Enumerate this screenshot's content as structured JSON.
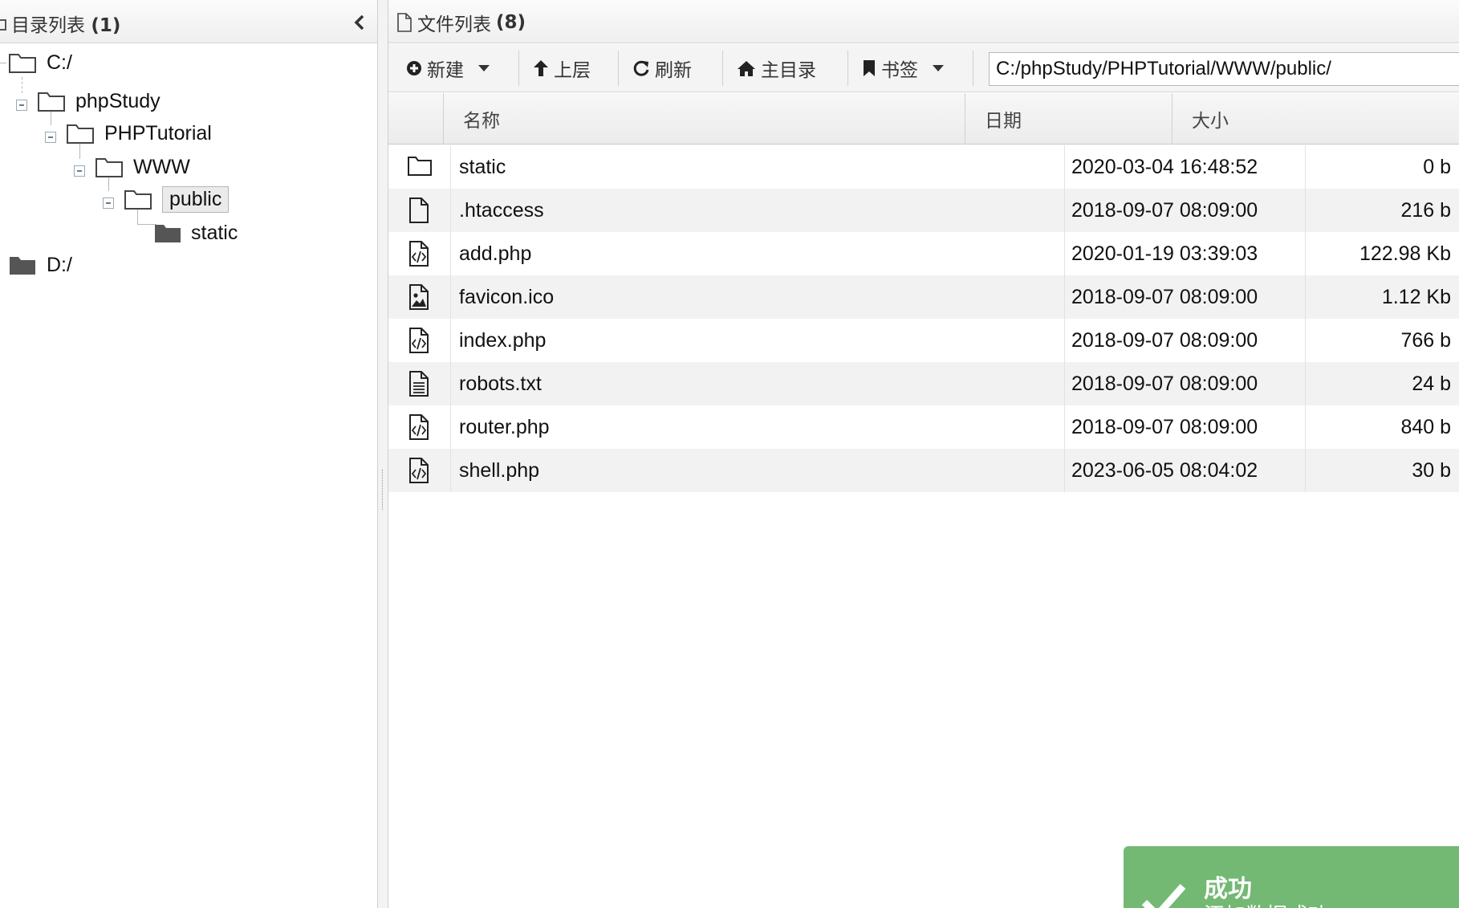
{
  "left_panel": {
    "title": "目录列表",
    "count": "(1)",
    "tree": [
      {
        "label": "C:/"
      },
      {
        "label": "phpStudy"
      },
      {
        "label": "PHPTutorial"
      },
      {
        "label": "WWW"
      },
      {
        "label": "public"
      },
      {
        "label": "static"
      },
      {
        "label": "D:/"
      }
    ]
  },
  "right_panel": {
    "title": "文件列表",
    "count": "(8)",
    "toolbar": {
      "new_label": "新建",
      "up_label": "上层",
      "refresh_label": "刷新",
      "home_label": "主目录",
      "bookmark_label": "书签",
      "path_value": "C:/phpStudy/PHPTutorial/WWW/public/"
    },
    "columns": {
      "name": "名称",
      "date": "日期",
      "size": "大小"
    },
    "files": [
      {
        "icon": "folder-icon",
        "name": "static",
        "date": "2020-03-04 16:48:52",
        "size": "0 b"
      },
      {
        "icon": "file-icon",
        "name": ".htaccess",
        "date": "2018-09-07 08:09:00",
        "size": "216 b"
      },
      {
        "icon": "code-file-icon",
        "name": "add.php",
        "date": "2020-01-19 03:39:03",
        "size": "122.98 Kb"
      },
      {
        "icon": "image-file-icon",
        "name": "favicon.ico",
        "date": "2018-09-07 08:09:00",
        "size": "1.12 Kb"
      },
      {
        "icon": "code-file-icon",
        "name": "index.php",
        "date": "2018-09-07 08:09:00",
        "size": "766 b"
      },
      {
        "icon": "text-file-icon",
        "name": "robots.txt",
        "date": "2018-09-07 08:09:00",
        "size": "24 b"
      },
      {
        "icon": "code-file-icon",
        "name": "router.php",
        "date": "2018-09-07 08:09:00",
        "size": "840 b"
      },
      {
        "icon": "code-file-icon",
        "name": "shell.php",
        "date": "2023-06-05 08:04:02",
        "size": "30 b"
      }
    ]
  },
  "toast": {
    "title": "成功",
    "message": "添加数据成功",
    "color": "#73b873"
  }
}
